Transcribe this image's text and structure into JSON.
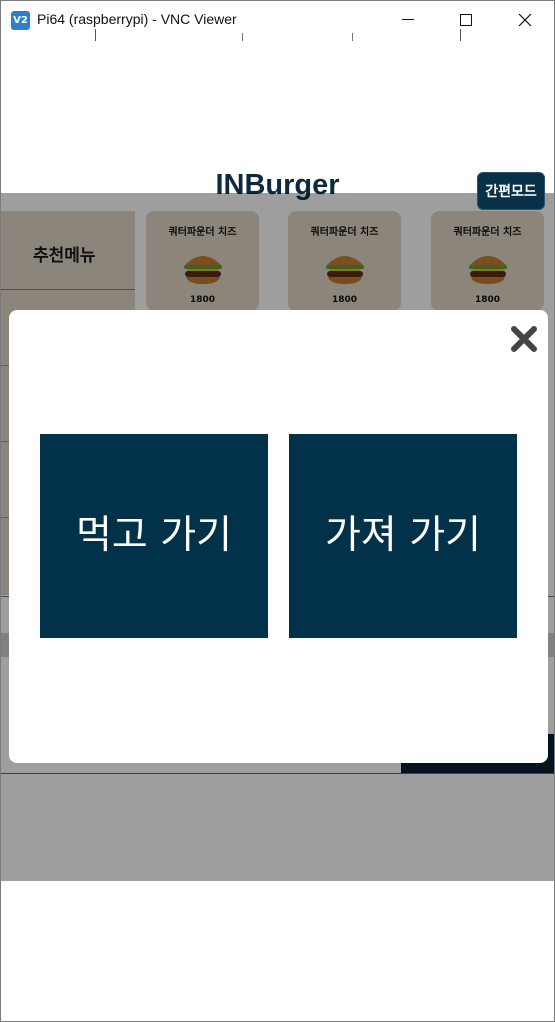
{
  "window": {
    "icon_text": "V2",
    "title": "Pi64 (raspberrypi) - VNC Viewer"
  },
  "header": {
    "brand": "INBurger",
    "easy_mode_label": "간편모드"
  },
  "sidebar": {
    "selected_category": "추천메뉴"
  },
  "menu": {
    "items": [
      {
        "name": "쿼터파운더 치즈",
        "price": "1800"
      },
      {
        "name": "쿼터파운더 치즈",
        "price": "1800"
      },
      {
        "name": "쿼터파운더 치즈",
        "price": "1800"
      }
    ]
  },
  "modal": {
    "options": [
      {
        "label": "먹고 가기"
      },
      {
        "label": "가져 가기"
      }
    ]
  },
  "colors": {
    "accent": "#02324a",
    "card": "#e3d7c7",
    "overlay": "#9c9c9c"
  }
}
